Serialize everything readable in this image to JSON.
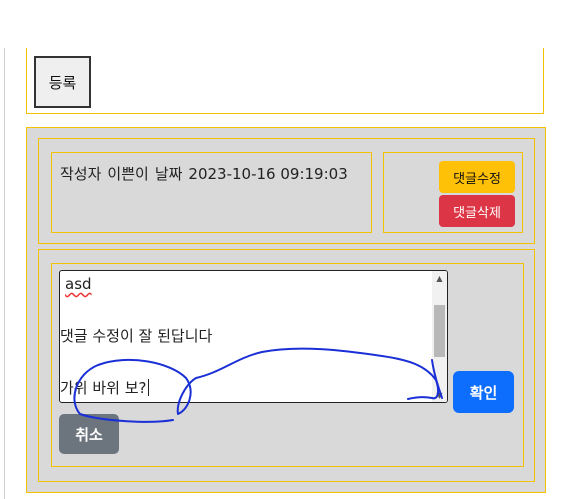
{
  "register_button": {
    "label": "등록"
  },
  "comment": {
    "author_label": "작성자",
    "author": "이쁜이",
    "date_label": "날짜",
    "datetime": "2023-10-16 09:19:03",
    "edit_button": "댓글수정",
    "delete_button": "댓글삭제"
  },
  "editor": {
    "lines": [
      "asd",
      "댓글 수정이 잘 된답니다",
      "가위 바위 보?"
    ],
    "confirm_button": "확인",
    "cancel_button": "취소"
  },
  "colors": {
    "panel_border": "#f2c200",
    "panel_bg": "#d9d9d9",
    "edit_btn": "#ffc107",
    "delete_btn": "#dc3545",
    "confirm_btn": "#0d6efd",
    "cancel_btn": "#6c757d",
    "annotation_ink": "#1a2fd6"
  },
  "icons": {
    "scroll_up": "▲",
    "scroll_down": "▼"
  }
}
